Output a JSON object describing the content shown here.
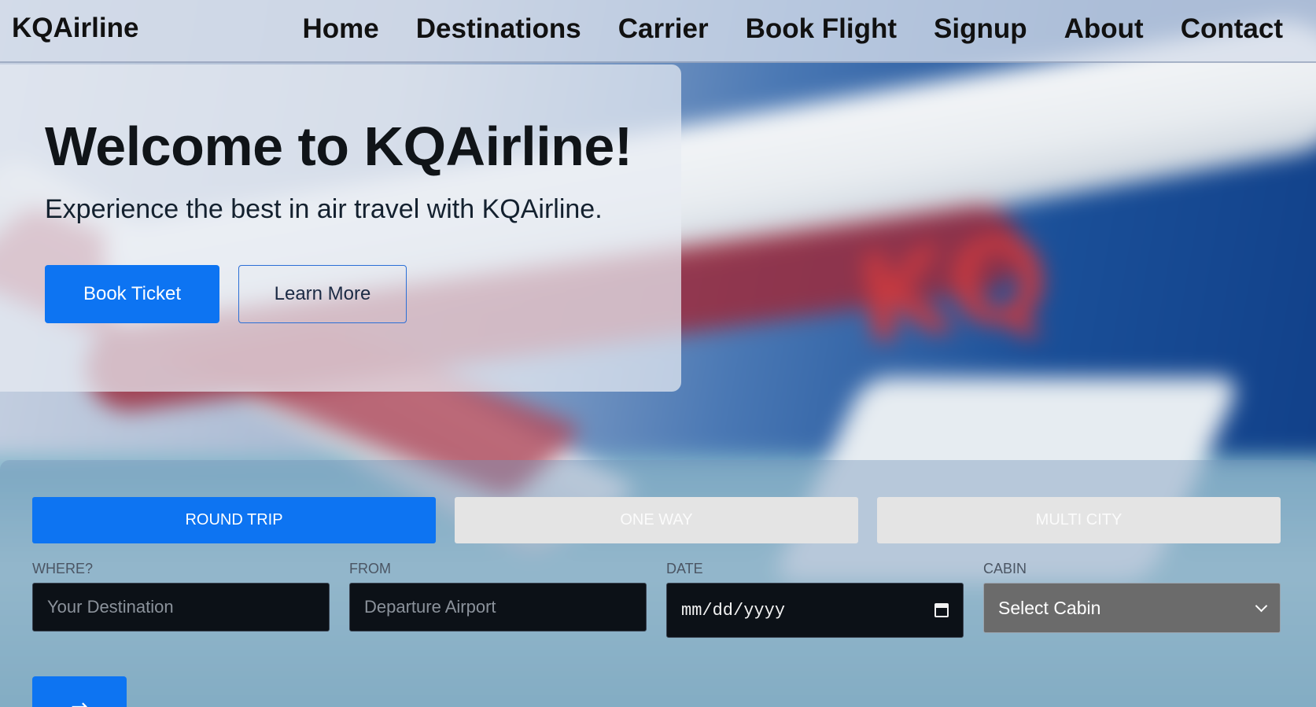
{
  "nav": {
    "brand": "KQAirline",
    "links": [
      "Home",
      "Destinations",
      "Carrier",
      "Book Flight",
      "Signup",
      "About",
      "Contact"
    ]
  },
  "hero": {
    "title": "Welcome to KQAirline!",
    "subtitle": "Experience the best in air travel with KQAirline.",
    "book_label": "Book Ticket",
    "learn_label": "Learn More",
    "background_logo": "KQ"
  },
  "booking": {
    "tabs": [
      {
        "label": "ROUND TRIP",
        "active": true
      },
      {
        "label": "ONE WAY",
        "active": false
      },
      {
        "label": "MULTI CITY",
        "active": false
      }
    ],
    "fields": {
      "where": {
        "label": "WHERE?",
        "placeholder": "Your Destination"
      },
      "from": {
        "label": "FROM",
        "placeholder": "Departure Airport"
      },
      "date": {
        "label": "DATE",
        "value": "mm/dd/yyyy"
      },
      "cabin": {
        "label": "CABIN",
        "value": "Select Cabin"
      }
    },
    "submit_icon": "arrow-right-icon"
  },
  "colors": {
    "accent": "#0d74f2",
    "tab_inactive": "#e4e4e4",
    "input_bg": "#0c1117"
  }
}
